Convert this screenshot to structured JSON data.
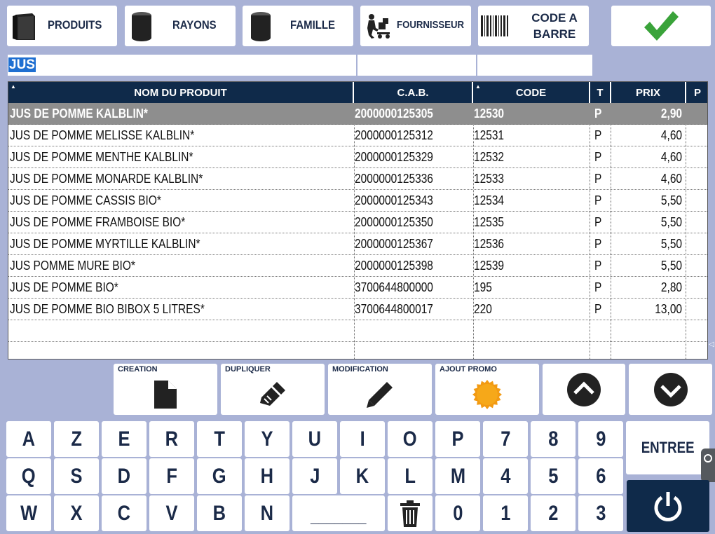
{
  "top_buttons": {
    "produits": "PRODUITS",
    "rayons": "RAYONS",
    "famille": "FAMILLE",
    "fournisseur": "FOURNISSEUR",
    "code_barre_1": "CODE A",
    "code_barre_2": "BARRE"
  },
  "search": {
    "value": "JUS"
  },
  "table": {
    "headers": {
      "nom": "NOM DU PRODUIT",
      "cab": "C.A.B.",
      "code": "CODE",
      "t": "T",
      "prix": "PRIX",
      "p": "P"
    },
    "rows": [
      {
        "nom": "JUS DE POMME KALBLIN*",
        "cab": "2000000125305",
        "code": "12530",
        "t": "P",
        "prix": "2,90"
      },
      {
        "nom": "JUS DE POMME MELISSE KALBLIN*",
        "cab": "2000000125312",
        "code": "12531",
        "t": "P",
        "prix": "4,60"
      },
      {
        "nom": "JUS DE POMME MENTHE KALBLIN*",
        "cab": "2000000125329",
        "code": "12532",
        "t": "P",
        "prix": "4,60"
      },
      {
        "nom": "JUS DE POMME MONARDE KALBLIN*",
        "cab": "2000000125336",
        "code": "12533",
        "t": "P",
        "prix": "4,60"
      },
      {
        "nom": "JUS DE POMME CASSIS BIO*",
        "cab": "2000000125343",
        "code": "12534",
        "t": "P",
        "prix": "5,50"
      },
      {
        "nom": "JUS DE POMME FRAMBOISE BIO*",
        "cab": "2000000125350",
        "code": "12535",
        "t": "P",
        "prix": "5,50"
      },
      {
        "nom": "JUS DE POMME MYRTILLE KALBLIN*",
        "cab": "2000000125367",
        "code": "12536",
        "t": "P",
        "prix": "5,50"
      },
      {
        "nom": "JUS POMME MURE BIO*",
        "cab": "2000000125398",
        "code": "12539",
        "t": "P",
        "prix": "5,50"
      },
      {
        "nom": "JUS DE POMME BIO*",
        "cab": "3700644800000",
        "code": "195",
        "t": "P",
        "prix": "2,80"
      },
      {
        "nom": "JUS DE POMME BIO BIBOX 5 LITRES*",
        "cab": "3700644800017",
        "code": "220",
        "t": "P",
        "prix": "13,00"
      }
    ]
  },
  "actions": {
    "creation": "CREATION",
    "dupliquer": "DUPLIQUER",
    "modification": "MODIFICATION",
    "ajout_promo": "AJOUT PROMO"
  },
  "keyboard": {
    "row1": [
      "A",
      "Z",
      "E",
      "R",
      "T",
      "Y",
      "U",
      "I",
      "O",
      "P",
      "7",
      "8",
      "9"
    ],
    "row2": [
      "Q",
      "S",
      "D",
      "F",
      "G",
      "H",
      "J",
      "K",
      "L",
      "M",
      "4",
      "5",
      "6"
    ],
    "row3": [
      "W",
      "X",
      "C",
      "V",
      "B",
      "N",
      "_______",
      "",
      "0",
      "1",
      "2",
      "3"
    ],
    "enter": "ENTREE"
  },
  "colors": {
    "background": "#a9b2d6",
    "header": "#0f2a4a",
    "selected_row": "#8e8e8e",
    "confirm_check": "#3aa33a",
    "promo_badge": "#f29a12"
  }
}
